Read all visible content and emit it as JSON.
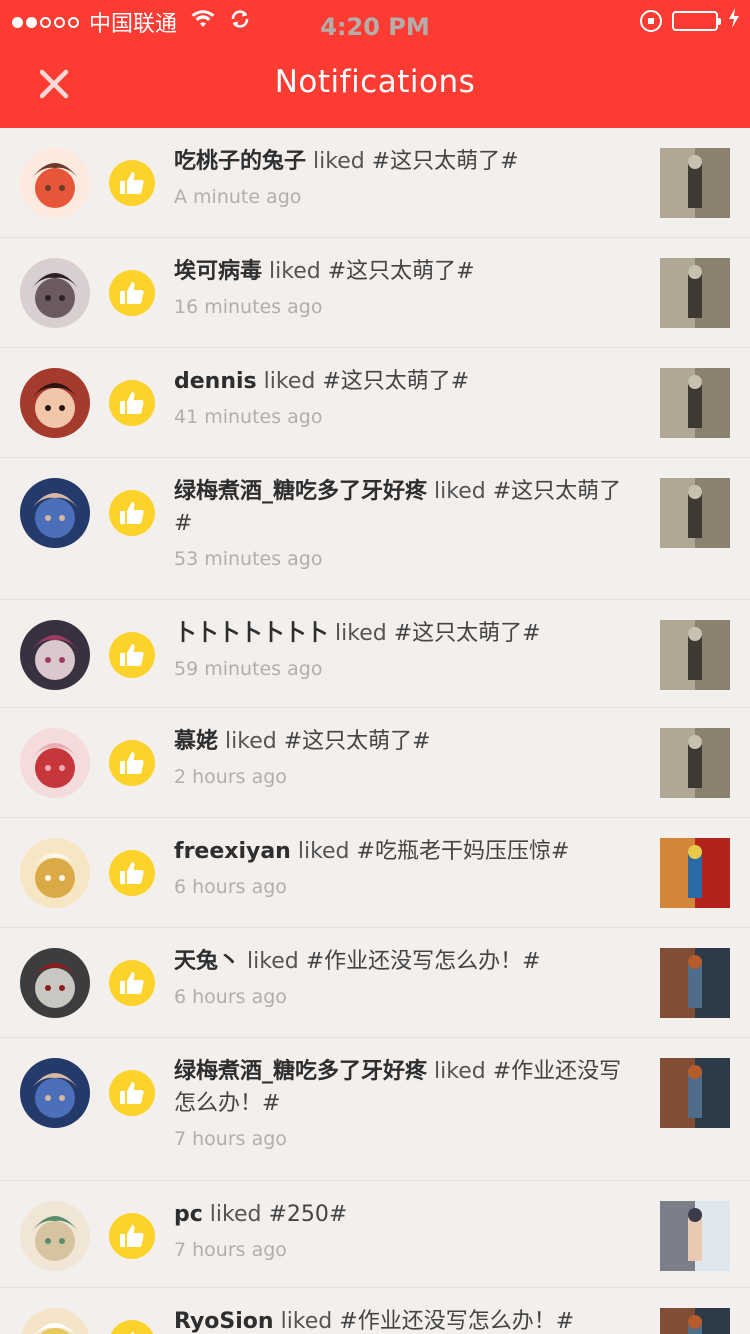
{
  "status_bar": {
    "carrier": "中国联通",
    "time": "4:20 PM"
  },
  "navbar": {
    "title": "Notifications"
  },
  "notifications": [
    {
      "user": "吃桃子的兔子",
      "action": "liked",
      "tag": "#这只太萌了#",
      "time": "A minute ago"
    },
    {
      "user": "埃可病毒",
      "action": "liked",
      "tag": "#这只太萌了#",
      "time": "16 minutes ago"
    },
    {
      "user": "dennis",
      "action": "liked",
      "tag": "#这只太萌了#",
      "time": "41 minutes ago"
    },
    {
      "user": "绿梅煮酒_糖吃多了牙好疼",
      "action": "liked",
      "tag": "#这只太萌了#",
      "time": "53 minutes ago"
    },
    {
      "user": "卜卜卜卜卜卜卜",
      "action": "liked",
      "tag": "#这只太萌了#",
      "time": "59 minutes ago"
    },
    {
      "user": "慕姥",
      "action": "liked",
      "tag": "#这只太萌了#",
      "time": "2 hours ago"
    },
    {
      "user": "freexiyan",
      "action": "liked",
      "tag": "#吃瓶老干妈压压惊#",
      "time": "6 hours ago"
    },
    {
      "user": "天兔丶",
      "action": "liked",
      "tag": "#作业还没写怎么办！#",
      "time": "6 hours ago"
    },
    {
      "user": "绿梅煮酒_糖吃多了牙好疼",
      "action": "liked",
      "tag": "#作业还没写怎么办！#",
      "time": "7 hours ago"
    },
    {
      "user": "pc",
      "action": "liked",
      "tag": "#250#",
      "time": "7 hours ago"
    },
    {
      "user": "RyoSion",
      "action": "liked",
      "tag": "#作业还没写怎么办！#",
      "time": ""
    }
  ],
  "icons": {
    "close": "close-icon",
    "like": "thumbs-up-icon"
  },
  "colors": {
    "header_red": "#fc3c33",
    "like_yellow": "#fdd22b",
    "background": "#f3efec"
  }
}
